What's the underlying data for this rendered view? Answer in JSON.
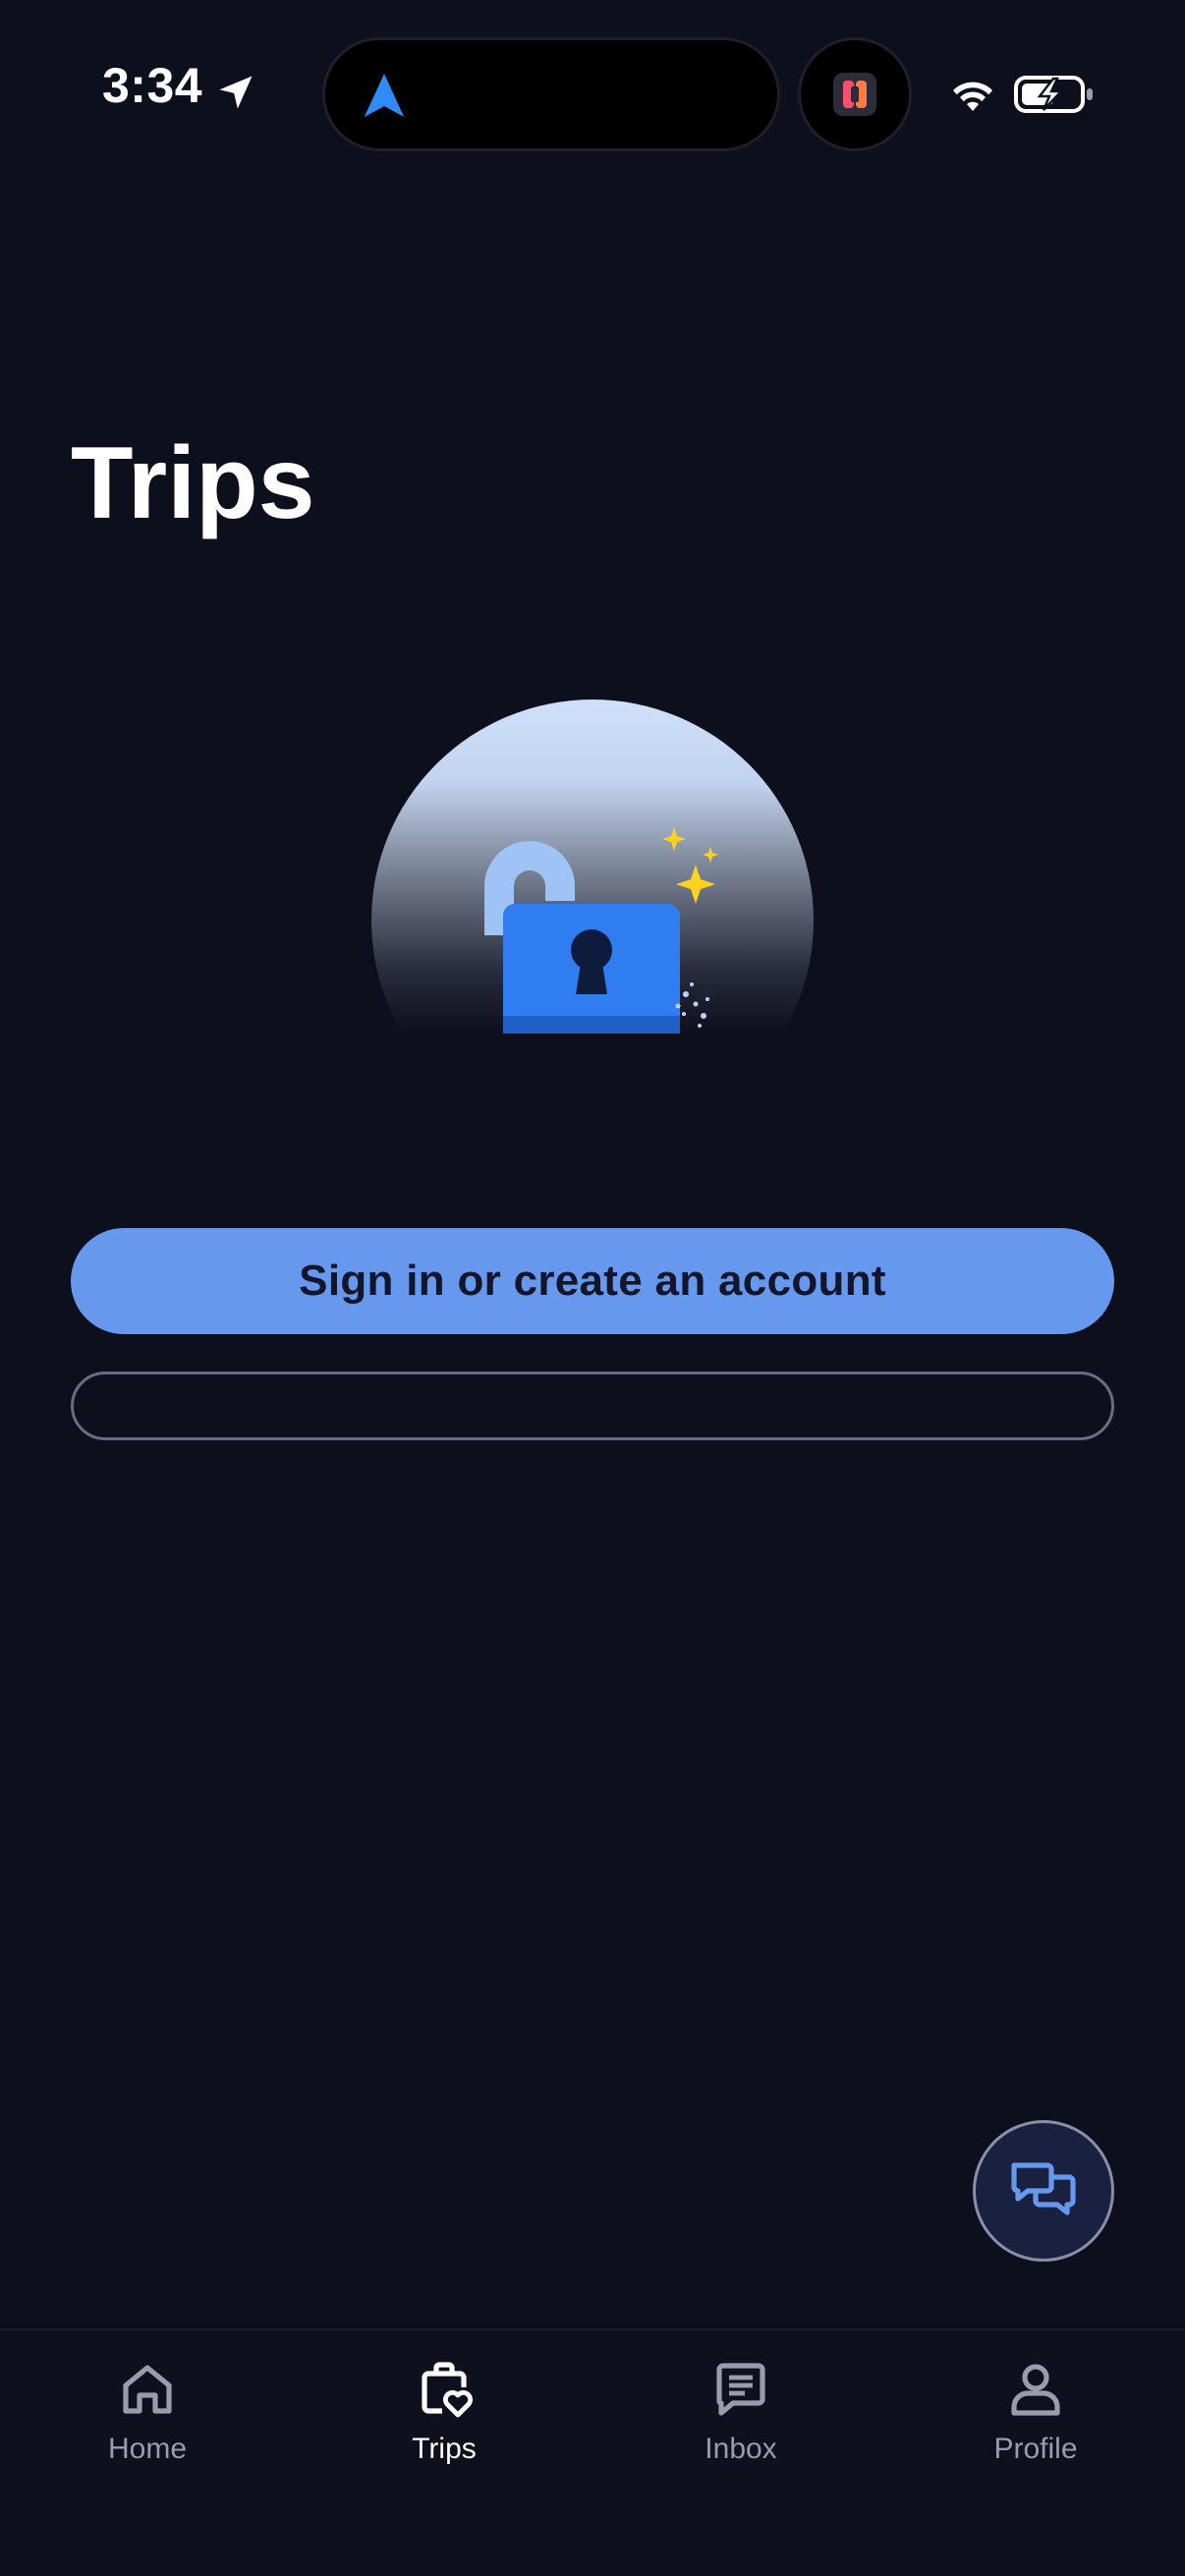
{
  "status_bar": {
    "time": "3:34"
  },
  "page": {
    "title": "Trips"
  },
  "illustration": {
    "icon": "unlocked-padlock-with-sparkles"
  },
  "actions": {
    "signin_label": "Sign in or create an account",
    "secondary_label": ""
  },
  "chat": {
    "icon": "chat-bubbles-icon"
  },
  "tabs": [
    {
      "label": "Home",
      "icon": "home-icon",
      "active": false
    },
    {
      "label": "Trips",
      "icon": "trips-bag-heart-icon",
      "active": true
    },
    {
      "label": "Inbox",
      "icon": "inbox-message-icon",
      "active": false
    },
    {
      "label": "Profile",
      "icon": "profile-person-icon",
      "active": false
    }
  ],
  "colors": {
    "background": "#0e0f1c",
    "primary_button": "#6699ee",
    "primary_button_text": "#13162a",
    "tab_inactive": "#9a9cac",
    "tab_active": "#ffffff",
    "accent_blue": "#2f7df0",
    "sparkle_yellow": "#ffd21f"
  }
}
